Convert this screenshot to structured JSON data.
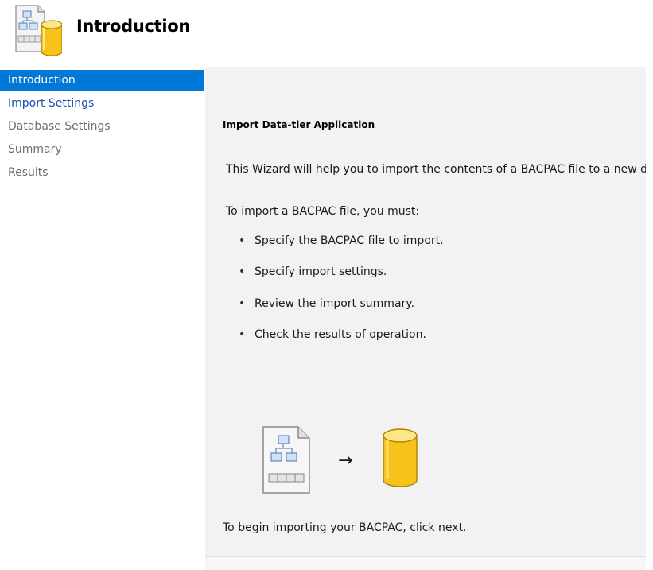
{
  "header": {
    "title": "Introduction",
    "icon": "bacpac-database-icon"
  },
  "sidebar": {
    "items": [
      {
        "label": "Introduction",
        "state": "selected"
      },
      {
        "label": "Import Settings",
        "state": "link"
      },
      {
        "label": "Database Settings",
        "state": "disabled"
      },
      {
        "label": "Summary",
        "state": "disabled"
      },
      {
        "label": "Results",
        "state": "disabled"
      }
    ]
  },
  "main": {
    "section_title": "Import Data-tier Application",
    "description": "This Wizard will help you to import the contents of a BACPAC file to a new database.",
    "intro": "To import a BACPAC file, you must:",
    "steps": [
      "Specify the BACPAC file to import.",
      "Specify import settings.",
      "Review the import summary.",
      "Check the results of operation."
    ],
    "illustration": {
      "left_icon": "bacpac-file-icon",
      "arrow": "→",
      "right_icon": "database-cylinder-icon"
    },
    "footer": "To begin importing your BACPAC, click next."
  },
  "colors": {
    "selected_bg": "#0078d7",
    "link": "#1a4fb0",
    "disabled": "#6d6d6d",
    "content_bg": "#f2f2f2",
    "cylinder": "#f7c21a"
  }
}
